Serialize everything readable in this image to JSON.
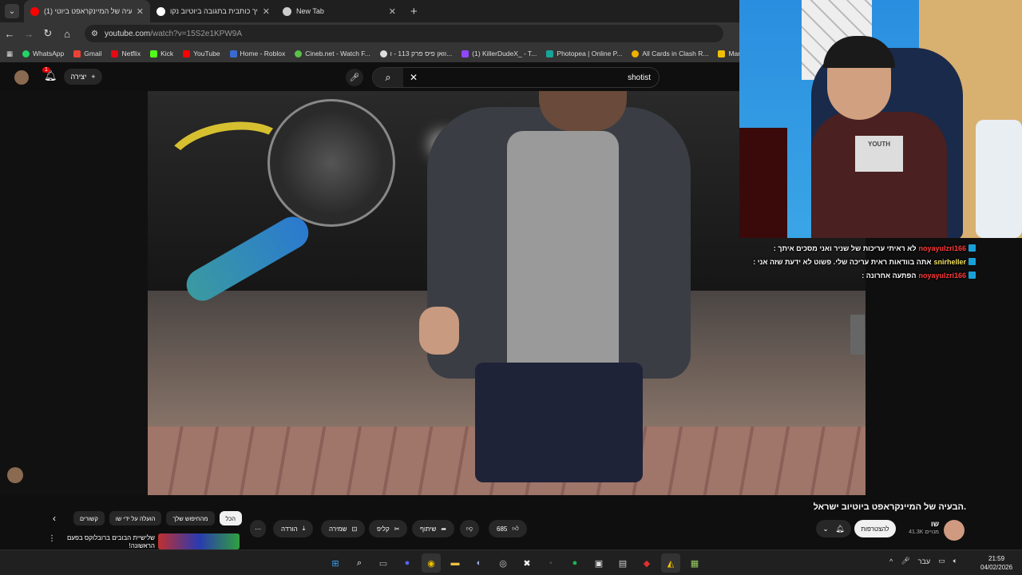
{
  "browser": {
    "tabs": [
      {
        "title": "(1) הבעיה של המיינקראפט ביוטי",
        "active": true
      },
      {
        "title": "איך כותבית בתגובה ביוטיוב נקו",
        "active": false
      },
      {
        "title": "New Tab",
        "active": false
      }
    ],
    "new_tab": "+",
    "url_host": "youtube.com",
    "url_path": "/watch?v=15S2e1KPW9A",
    "bookmarks": [
      "WhatsApp",
      "Gmail",
      "Netflix",
      "Kick",
      "YouTube",
      "Home - Roblox",
      "Cineb.net - Watch F...",
      "וואן פיס פרק 113 - ו...",
      "(1) KillerDudeX_ - T...",
      "Photopea | Online P...",
      "All Cards in Clash R...",
      "Marvel"
    ]
  },
  "youtube_header": {
    "notification_count": "1",
    "create_label": "יצירה",
    "search_query": "shotist"
  },
  "chat": [
    {
      "user": "noyayulzri166",
      "message": "לא ראיתי עריכות של שניר ואני מסכים איתך :",
      "color": "#ff3a3a"
    },
    {
      "user": "snirheller",
      "message": "אתה בוודאות ראית עריכה שלי. פשוט לא ידעת שזה אני :",
      "color": "#f0e060"
    },
    {
      "user": "noyayulzri166",
      "message": "הפתעה אחרונה :",
      "color": "#ff3a3a"
    }
  ],
  "webcam": {
    "shirt_text": "YOUTH"
  },
  "video": {
    "title": "הבעיה של המיינקראפט ביוטיוב ישראל.",
    "channel_name": "שו",
    "subscribers": "41.3K מנויים",
    "subscribe_label": "להצטרפות",
    "like_count": "685",
    "share_label": "שיתוף",
    "clip_label": "קליפ",
    "save_label": "שמירה",
    "download_label": "הורדה"
  },
  "recommendations": {
    "chips": [
      "הכל",
      "מהחיפוש שלך",
      "הועלה על ידי שו",
      "קשורים"
    ],
    "first_title": "שלישיית הבובים ברובלוקס בפעם הראשונה!"
  },
  "taskbar": {
    "language": "עבר",
    "time": "21:59",
    "date": "04/02/2026"
  }
}
